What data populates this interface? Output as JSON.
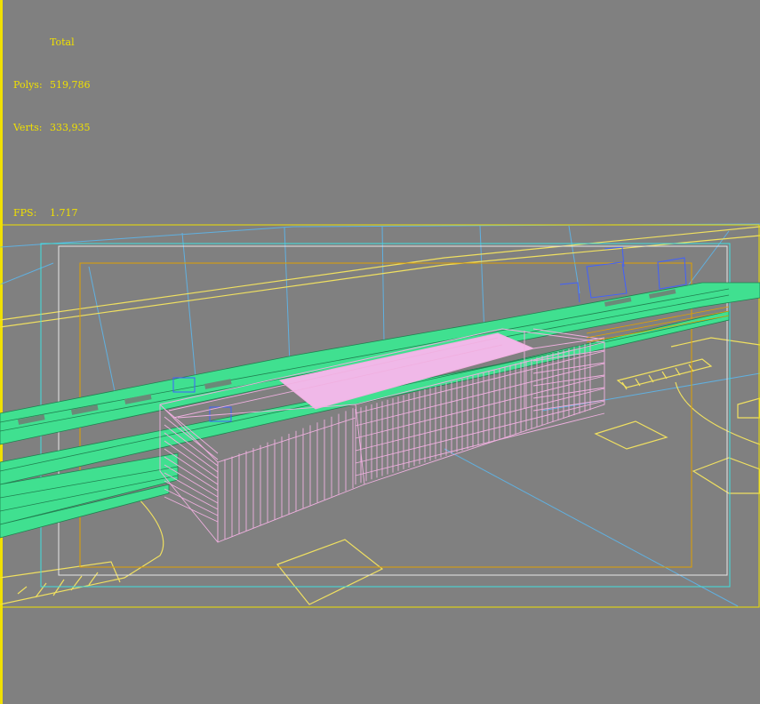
{
  "stats": {
    "header": "Total",
    "polys_label": "Polys:",
    "polys_value": "519,786",
    "verts_label": "Verts:",
    "verts_value": "333,935",
    "fps_label": "FPS:",
    "fps_value": "1.717"
  },
  "colors": {
    "background": "#808080",
    "stats_text": "#f0e000",
    "safe_frame_outer": "#f0e000",
    "safe_frame_cyan": "#40e0e0",
    "safe_frame_white": "#e8e8e8",
    "safe_frame_orange": "#e0a000",
    "ground_lines": "#f0e060",
    "platform_fill": "#40e090",
    "building_wire": "#f0b0e0",
    "roof_fill": "#f0b8e8",
    "camera_lines": "#60b0e0",
    "blue_objects": "#4060ff"
  }
}
